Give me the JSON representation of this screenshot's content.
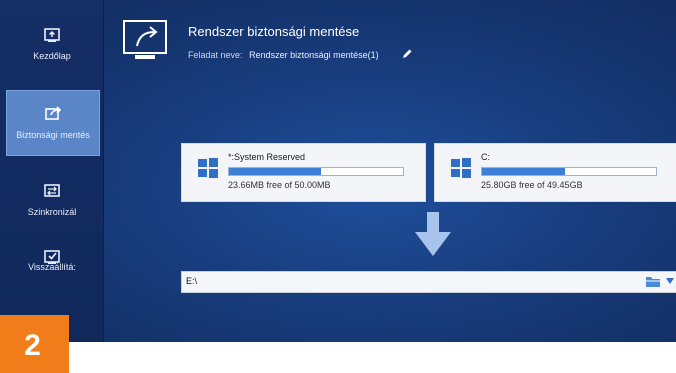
{
  "sidebar": {
    "items": [
      {
        "label": "Kezdőlap",
        "icon": "home-icon",
        "active": false
      },
      {
        "label": "Biztonsági mentés",
        "icon": "backup-icon",
        "active": true
      },
      {
        "label": "Szinkronizál",
        "icon": "sync-icon",
        "active": false
      },
      {
        "label": "Visszaállítá:",
        "icon": "restore-icon",
        "active": false
      }
    ]
  },
  "header": {
    "title": "Rendszer biztonsági mentése",
    "task_label": "Feladat neve:",
    "task_name": "Rendszer biztonsági mentése(1)",
    "icon": "backup-share-icon"
  },
  "sources": [
    {
      "label": "*:System Reserved",
      "info": "23.66MB free of 50.00MB",
      "used_fraction": 0.527
    },
    {
      "label": "C:",
      "info": "25.80GB free of 49.45GB",
      "used_fraction": 0.478
    }
  ],
  "destination": {
    "path": "E:\\"
  },
  "badge": {
    "number": "2"
  },
  "colors": {
    "accent": "#3d7fd4",
    "badge": "#f07d1a",
    "active_nav": "#5a86c8"
  }
}
